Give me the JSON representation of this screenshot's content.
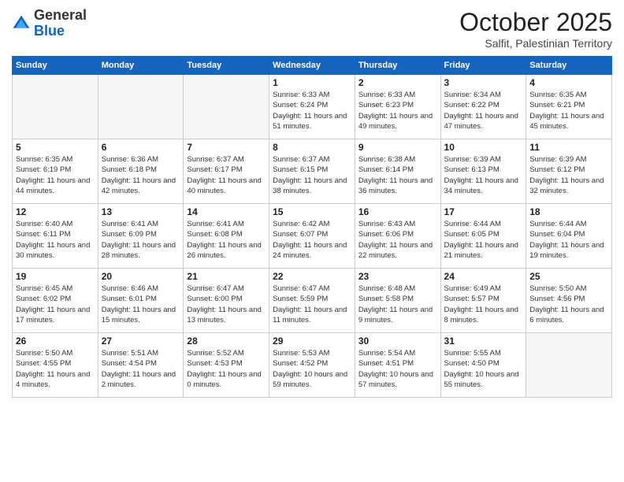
{
  "logo": {
    "general": "General",
    "blue": "Blue"
  },
  "header": {
    "month": "October 2025",
    "location": "Salfit, Palestinian Territory"
  },
  "weekdays": [
    "Sunday",
    "Monday",
    "Tuesday",
    "Wednesday",
    "Thursday",
    "Friday",
    "Saturday"
  ],
  "weeks": [
    [
      {
        "day": "",
        "text": ""
      },
      {
        "day": "",
        "text": ""
      },
      {
        "day": "",
        "text": ""
      },
      {
        "day": "1",
        "text": "Sunrise: 6:33 AM\nSunset: 6:24 PM\nDaylight: 11 hours and 51 minutes."
      },
      {
        "day": "2",
        "text": "Sunrise: 6:33 AM\nSunset: 6:23 PM\nDaylight: 11 hours and 49 minutes."
      },
      {
        "day": "3",
        "text": "Sunrise: 6:34 AM\nSunset: 6:22 PM\nDaylight: 11 hours and 47 minutes."
      },
      {
        "day": "4",
        "text": "Sunrise: 6:35 AM\nSunset: 6:21 PM\nDaylight: 11 hours and 45 minutes."
      }
    ],
    [
      {
        "day": "5",
        "text": "Sunrise: 6:35 AM\nSunset: 6:19 PM\nDaylight: 11 hours and 44 minutes."
      },
      {
        "day": "6",
        "text": "Sunrise: 6:36 AM\nSunset: 6:18 PM\nDaylight: 11 hours and 42 minutes."
      },
      {
        "day": "7",
        "text": "Sunrise: 6:37 AM\nSunset: 6:17 PM\nDaylight: 11 hours and 40 minutes."
      },
      {
        "day": "8",
        "text": "Sunrise: 6:37 AM\nSunset: 6:15 PM\nDaylight: 11 hours and 38 minutes."
      },
      {
        "day": "9",
        "text": "Sunrise: 6:38 AM\nSunset: 6:14 PM\nDaylight: 11 hours and 36 minutes."
      },
      {
        "day": "10",
        "text": "Sunrise: 6:39 AM\nSunset: 6:13 PM\nDaylight: 11 hours and 34 minutes."
      },
      {
        "day": "11",
        "text": "Sunrise: 6:39 AM\nSunset: 6:12 PM\nDaylight: 11 hours and 32 minutes."
      }
    ],
    [
      {
        "day": "12",
        "text": "Sunrise: 6:40 AM\nSunset: 6:11 PM\nDaylight: 11 hours and 30 minutes."
      },
      {
        "day": "13",
        "text": "Sunrise: 6:41 AM\nSunset: 6:09 PM\nDaylight: 11 hours and 28 minutes."
      },
      {
        "day": "14",
        "text": "Sunrise: 6:41 AM\nSunset: 6:08 PM\nDaylight: 11 hours and 26 minutes."
      },
      {
        "day": "15",
        "text": "Sunrise: 6:42 AM\nSunset: 6:07 PM\nDaylight: 11 hours and 24 minutes."
      },
      {
        "day": "16",
        "text": "Sunrise: 6:43 AM\nSunset: 6:06 PM\nDaylight: 11 hours and 22 minutes."
      },
      {
        "day": "17",
        "text": "Sunrise: 6:44 AM\nSunset: 6:05 PM\nDaylight: 11 hours and 21 minutes."
      },
      {
        "day": "18",
        "text": "Sunrise: 6:44 AM\nSunset: 6:04 PM\nDaylight: 11 hours and 19 minutes."
      }
    ],
    [
      {
        "day": "19",
        "text": "Sunrise: 6:45 AM\nSunset: 6:02 PM\nDaylight: 11 hours and 17 minutes."
      },
      {
        "day": "20",
        "text": "Sunrise: 6:46 AM\nSunset: 6:01 PM\nDaylight: 11 hours and 15 minutes."
      },
      {
        "day": "21",
        "text": "Sunrise: 6:47 AM\nSunset: 6:00 PM\nDaylight: 11 hours and 13 minutes."
      },
      {
        "day": "22",
        "text": "Sunrise: 6:47 AM\nSunset: 5:59 PM\nDaylight: 11 hours and 11 minutes."
      },
      {
        "day": "23",
        "text": "Sunrise: 6:48 AM\nSunset: 5:58 PM\nDaylight: 11 hours and 9 minutes."
      },
      {
        "day": "24",
        "text": "Sunrise: 6:49 AM\nSunset: 5:57 PM\nDaylight: 11 hours and 8 minutes."
      },
      {
        "day": "25",
        "text": "Sunrise: 5:50 AM\nSunset: 4:56 PM\nDaylight: 11 hours and 6 minutes."
      }
    ],
    [
      {
        "day": "26",
        "text": "Sunrise: 5:50 AM\nSunset: 4:55 PM\nDaylight: 11 hours and 4 minutes."
      },
      {
        "day": "27",
        "text": "Sunrise: 5:51 AM\nSunset: 4:54 PM\nDaylight: 11 hours and 2 minutes."
      },
      {
        "day": "28",
        "text": "Sunrise: 5:52 AM\nSunset: 4:53 PM\nDaylight: 11 hours and 0 minutes."
      },
      {
        "day": "29",
        "text": "Sunrise: 5:53 AM\nSunset: 4:52 PM\nDaylight: 10 hours and 59 minutes."
      },
      {
        "day": "30",
        "text": "Sunrise: 5:54 AM\nSunset: 4:51 PM\nDaylight: 10 hours and 57 minutes."
      },
      {
        "day": "31",
        "text": "Sunrise: 5:55 AM\nSunset: 4:50 PM\nDaylight: 10 hours and 55 minutes."
      },
      {
        "day": "",
        "text": ""
      }
    ]
  ]
}
